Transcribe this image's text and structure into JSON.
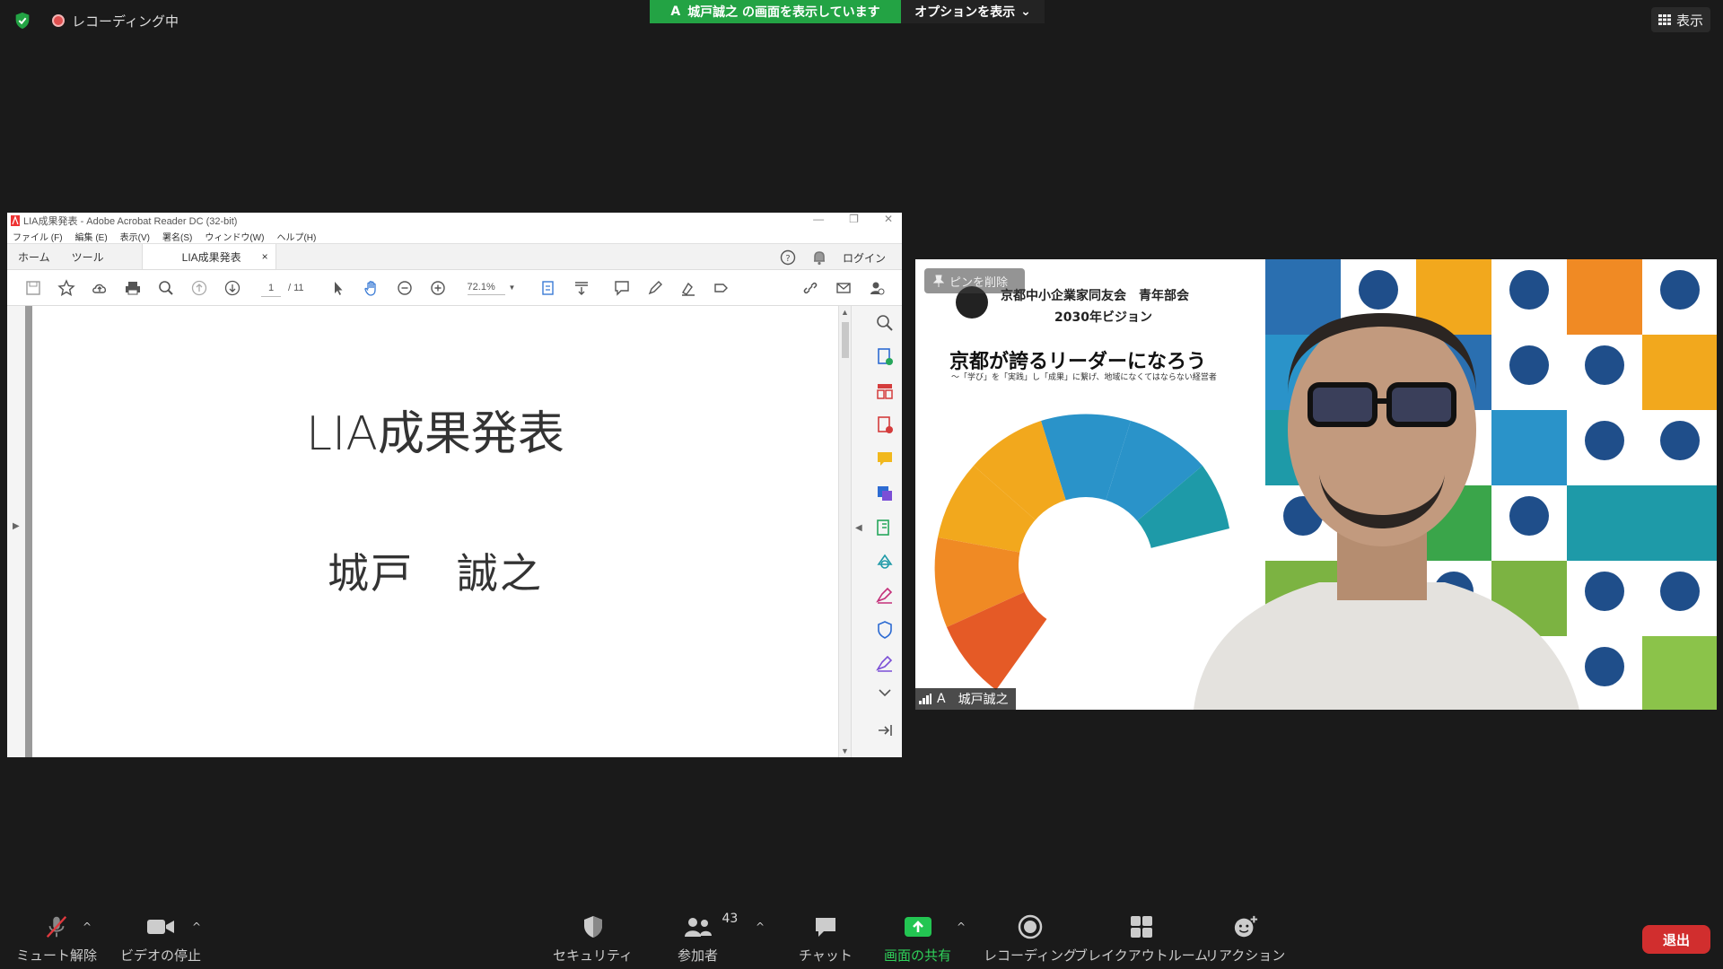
{
  "top": {
    "recording_label": "レコーディング中",
    "share_banner_prefix": "A",
    "share_banner_text": "城戸誠之 の画面を表示しています",
    "options_label": "オプションを表示",
    "view_label": "表示"
  },
  "acrobat": {
    "window_title": "LIA成果発表 - Adobe Acrobat Reader DC (32-bit)",
    "menu": [
      "ファイル (F)",
      "編集 (E)",
      "表示(V)",
      "署名(S)",
      "ウィンドウ(W)",
      "ヘルプ(H)"
    ],
    "tabs": {
      "home": "ホーム",
      "tools": "ツール",
      "document": "LIA成果発表",
      "close": "×"
    },
    "login_label": "ログイン",
    "page_current": "1",
    "page_total": "/ 11",
    "zoom": "72.1%",
    "document": {
      "title": "LIA成果発表",
      "author": "城戸　誠之"
    }
  },
  "video": {
    "pin_label": "ピンを削除",
    "participant_name": "城戸誠之",
    "participant_initial": "A",
    "bg_title1": "京都中小企業家同友会　青年部会",
    "bg_title2": "2030年ビジョン",
    "bg_headline": "京都が誇るリーダーになろう",
    "bg_sub": "〜「学び」を「実践」し「成果」に繋げ、地域になくてはならない経営者"
  },
  "controls": {
    "mute": "ミュート解除",
    "video": "ビデオの停止",
    "security": "セキュリティ",
    "participants": "参加者",
    "participants_count": "43",
    "chat": "チャット",
    "share": "画面の共有",
    "record": "レコーディング",
    "breakout": "ブレイクアウトルーム",
    "reactions": "リアクション",
    "leave": "退出"
  },
  "colors": {
    "share_green": "#23a344",
    "leave_red": "#d12e2e",
    "bar_bg": "#1a1a1a"
  }
}
